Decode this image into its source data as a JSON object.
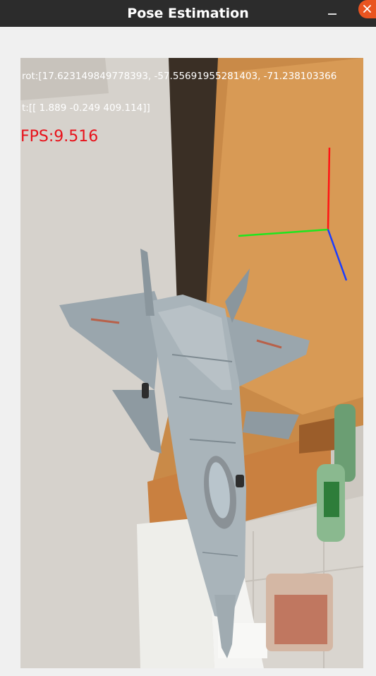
{
  "window": {
    "title": "Pose Estimation",
    "minimize_icon": "minimize-icon",
    "close_icon": "close-icon",
    "close_color": "#e95420"
  },
  "overlay": {
    "rotation_text": "rot:[17.623149849778393, -57.55691955281403, -71.238103366",
    "translation_text": "t:[[   1.889   -0.249  409.114]]",
    "fps_text": "FPS:9.516",
    "text_color": "#ffffff",
    "fps_color": "#e8111a"
  },
  "pose_axes": {
    "x_axis_color": "#1a3dff",
    "y_axis_color": "#1ee61e",
    "z_axis_color": "#ff1414"
  },
  "camera_frame": {
    "subject": "fighter-jet-model-icon"
  }
}
